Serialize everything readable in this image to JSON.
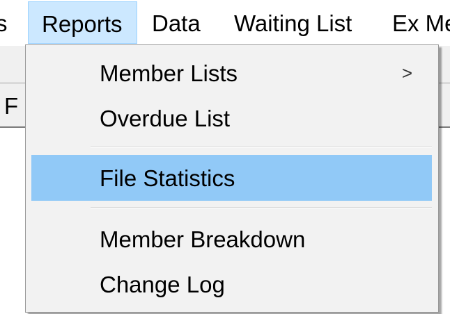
{
  "menubar": {
    "items": [
      {
        "label": "s"
      },
      {
        "label": "Reports"
      },
      {
        "label": "Data"
      },
      {
        "label": "Waiting List"
      },
      {
        "label": "Ex Me"
      }
    ]
  },
  "background": {
    "partial_label": "F"
  },
  "dropdown": {
    "items": [
      {
        "label": "Member Lists",
        "submenu_glyph": ">"
      },
      {
        "label": "Overdue List"
      },
      {
        "label": "File Statistics"
      },
      {
        "label": "Member Breakdown"
      },
      {
        "label": "Change Log"
      }
    ],
    "highlight_color": "#91c9f7",
    "open_menu_color": "#cce8ff"
  }
}
